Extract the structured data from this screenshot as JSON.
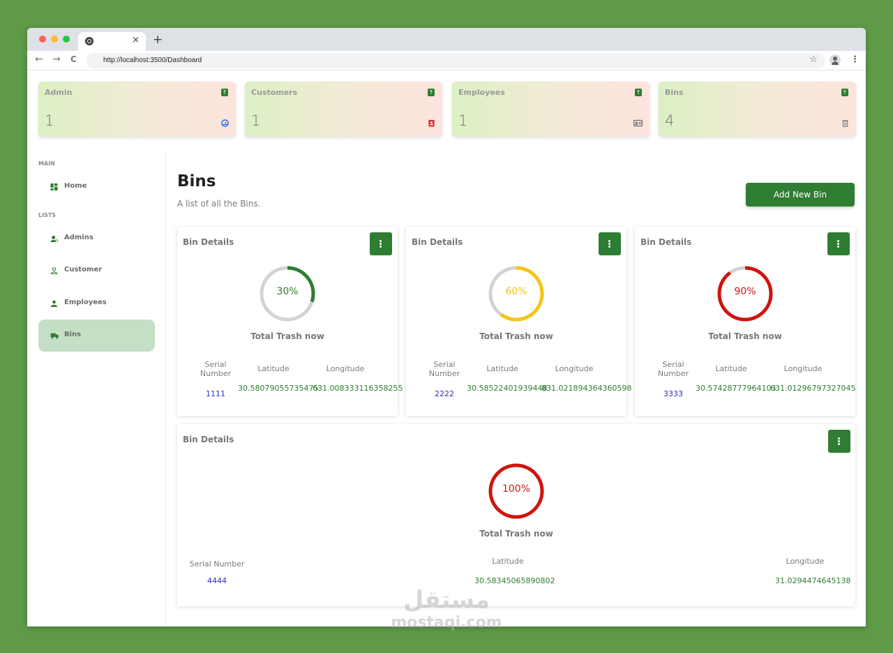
{
  "browser": {
    "url": "http://localhost:3500/Dashboard",
    "tab_close": "×",
    "new_tab": "+",
    "back": "←",
    "forward": "→",
    "reload": "C",
    "star": "☆",
    "menu": "⋮"
  },
  "widgets": [
    {
      "title": "Admin",
      "count": "1",
      "icon": "dashboard-gauge-icon",
      "icon_color": "#1e6fd9"
    },
    {
      "title": "Customers",
      "count": "1",
      "icon": "customer-badge-icon",
      "icon_color": "#d32f2f"
    },
    {
      "title": "Employees",
      "count": "1",
      "icon": "id-card-icon",
      "icon_color": "#555555"
    },
    {
      "title": "Bins",
      "count": "4",
      "icon": "trash-icon",
      "icon_color": "#777777"
    }
  ],
  "widget_arrow": "↑",
  "sidebar": {
    "main_label": "MAIN",
    "lists_label": "LISTS",
    "items": [
      {
        "label": "Home",
        "icon": "dashboard-icon"
      },
      {
        "label": "Admins",
        "icon": "admin-icon"
      },
      {
        "label": "Customer",
        "icon": "person-outline-icon"
      },
      {
        "label": "Employees",
        "icon": "person-icon"
      },
      {
        "label": "Bins",
        "icon": "truck-icon",
        "active": true
      }
    ]
  },
  "page": {
    "title": "Bins",
    "subtitle": "A list of all the Bins.",
    "add_button": "Add New Bin"
  },
  "bins": [
    {
      "title": "Bin Details",
      "percent": 30,
      "percent_label": "30%",
      "color": "#2e7d32",
      "caption": "Total Trash now",
      "serial_header": "Serial Number",
      "lat_header": "Latitude",
      "lng_header": "Longitude",
      "serial": "1111",
      "latitude": "30.58079055735475",
      "longitude": "631.008333116358255"
    },
    {
      "title": "Bin Details",
      "percent": 60,
      "percent_label": "60%",
      "color": "#f5c518",
      "caption": "Total Trash now",
      "serial_header": "Serial Number",
      "lat_header": "Latitude",
      "lng_header": "Longitude",
      "serial": "2222",
      "latitude": "30.58522401939448",
      "longitude": "831.021894364360598"
    },
    {
      "title": "Bin Details",
      "percent": 90,
      "percent_label": "90%",
      "color": "#d0140f",
      "caption": "Total Trash now",
      "serial_header": "Serial Number",
      "lat_header": "Latitude",
      "lng_header": "Longitude",
      "serial": "3333",
      "latitude": "30.57428777964103",
      "longitude": "631.01296797327045"
    },
    {
      "title": "Bin Details",
      "percent": 100,
      "percent_label": "100%",
      "color": "#d0140f",
      "caption": "Total Trash now",
      "serial_header": "Serial Number",
      "lat_header": "Latitude",
      "lng_header": "Longitude",
      "serial": "4444",
      "latitude": "30.58345065890802",
      "longitude": "31.0294474645138"
    }
  ],
  "watermark": {
    "arabic": "مستقل",
    "latin": "mostaqi.com"
  }
}
